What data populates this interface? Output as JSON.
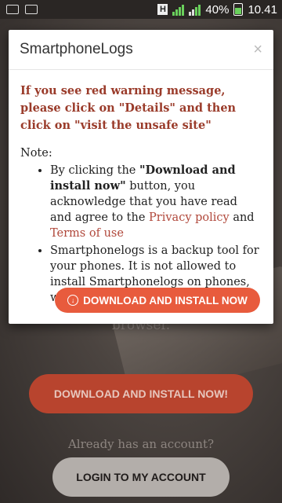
{
  "status": {
    "battery": "40%",
    "time": "10.41",
    "network_letter": "H"
  },
  "modal": {
    "title": "SmartphoneLogs",
    "close": "×",
    "warning": "If you see red warning message, please click on \"Details\" and then click on \"visit the unsafe site\"",
    "note_label": "Note:",
    "bullet1_pre": "By clicking the ",
    "bullet1_bold": "\"Download and install now\"",
    "bullet1_post": " button, you acknowledge that you have read and agree to the ",
    "privacy_link": "Privacy policy",
    "and": " and ",
    "terms_link": "Terms of use",
    "bullet2": "Smartphonelogs is a backup tool for your phones. It is not allowed to install Smartphonelogs on phones, which are not owned by the you.",
    "download_button": "DOWNLOAD AND INSTALL NOW",
    "download_icon": "download-circle-icon"
  },
  "background": {
    "browser_text": "browser.",
    "download_button": "DOWNLOAD AND INSTALL NOW!",
    "account_prompt": "Already has an account?",
    "login_button": "LOGIN TO MY ACCOUNT"
  },
  "colors": {
    "accent": "#e85b3d",
    "warning": "#9a3b2a",
    "link": "#b0473a"
  }
}
